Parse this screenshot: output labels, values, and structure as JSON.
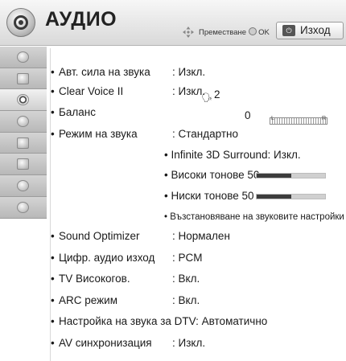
{
  "header": {
    "title": "АУДИО",
    "move_hint": "Преместване",
    "ok_label": "OK",
    "exit_key": "⏻",
    "exit_label": "Изход"
  },
  "sidebar": {
    "items": [
      {
        "icon": "picture-icon"
      },
      {
        "icon": "screen-icon"
      },
      {
        "icon": "audio-icon",
        "active": true
      },
      {
        "icon": "time-icon"
      },
      {
        "icon": "lock-icon"
      },
      {
        "icon": "options-icon"
      },
      {
        "icon": "network-icon"
      },
      {
        "icon": "support-icon"
      }
    ]
  },
  "settings": [
    {
      "label": "Авт. сила на звука",
      "value": ": Изкл."
    },
    {
      "label": "Clear Voice II",
      "value": ": Изкл.",
      "level": "2"
    },
    {
      "label": "Баланс",
      "value": "",
      "level": "0"
    },
    {
      "label": "Режим на звука",
      "value": ": Стандартно"
    },
    {
      "label": "Sound Optimizer",
      "value": ": Нормален"
    },
    {
      "label": "Цифр. аудио изход",
      "value": ": PCM"
    },
    {
      "label": "TV Високогов.",
      "value": ": Вкл."
    },
    {
      "label": "ARC режим",
      "value": ": Вкл."
    },
    {
      "label": "Настройка на звука за DTV: Автоматично",
      "value": ""
    },
    {
      "label": "AV синхронизация",
      "value": ": Изкл."
    }
  ],
  "sound_mode_sub": {
    "surround": "• Infinite 3D Surround: Изкл.",
    "treble": "• Високи тонове 50",
    "treble_level": 0.5,
    "bass": "• Ниски тонове 50",
    "bass_level": 0.5,
    "reset": "• Възстановяване на звуковите настройки"
  },
  "balance_bar": {
    "left": "L",
    "right": "R"
  },
  "colors": {
    "bar_fill": "#3c3c3c",
    "bar_bg": "#d0d0d0"
  }
}
